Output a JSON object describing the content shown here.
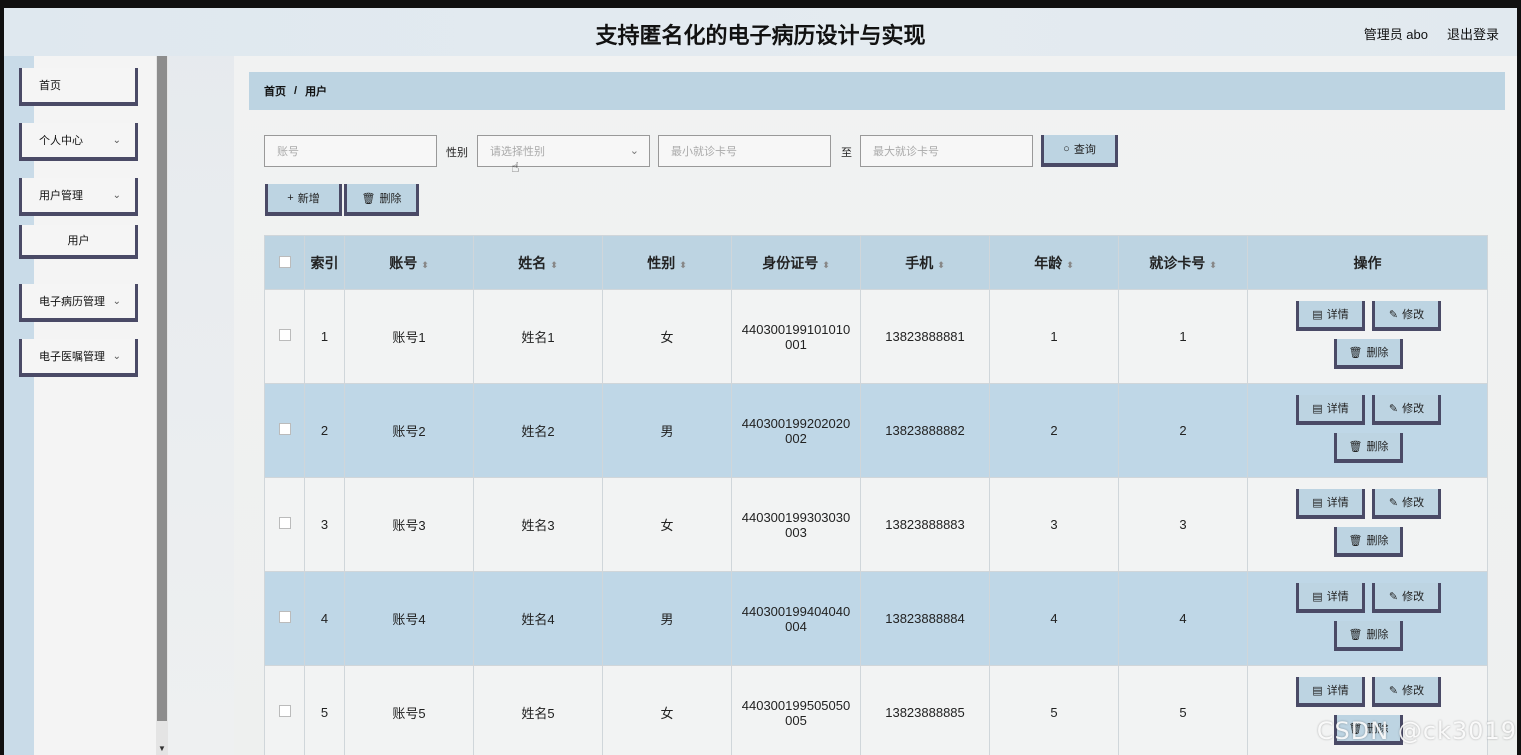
{
  "header": {
    "title": "支持匿名化的电子病历设计与实现",
    "user": "管理员 abo",
    "logout": "退出登录"
  },
  "sidebar": {
    "items": [
      {
        "label": "首页"
      },
      {
        "label": "个人中心"
      },
      {
        "label": "用户管理"
      },
      {
        "label": "用户"
      },
      {
        "label": "电子病历管理"
      },
      {
        "label": "电子医嘱管理"
      }
    ]
  },
  "breadcrumb": {
    "home": "首页",
    "sep": "/",
    "current": "用户"
  },
  "search": {
    "account_placeholder": "账号",
    "gender_label": "性别",
    "gender_placeholder": "请选择性别",
    "min_card_placeholder": "最小就诊卡号",
    "to_label": "至",
    "max_card_placeholder": "最大就诊卡号",
    "query_label": "查询"
  },
  "actions": {
    "add_label": "新增",
    "delete_label": "删除"
  },
  "table": {
    "headers": [
      "索引",
      "账号",
      "姓名",
      "性别",
      "身份证号",
      "手机",
      "年龄",
      "就诊卡号",
      "操作"
    ],
    "rows": [
      {
        "index": "1",
        "account": "账号1",
        "name": "姓名1",
        "gender": "女",
        "id_number_line1": "440300199101010",
        "id_number_line2": "001",
        "phone": "13823888881",
        "age": "1",
        "card": "1"
      },
      {
        "index": "2",
        "account": "账号2",
        "name": "姓名2",
        "gender": "男",
        "id_number_line1": "440300199202020",
        "id_number_line2": "002",
        "phone": "13823888882",
        "age": "2",
        "card": "2"
      },
      {
        "index": "3",
        "account": "账号3",
        "name": "姓名3",
        "gender": "女",
        "id_number_line1": "440300199303030",
        "id_number_line2": "003",
        "phone": "13823888883",
        "age": "3",
        "card": "3"
      },
      {
        "index": "4",
        "account": "账号4",
        "name": "姓名4",
        "gender": "男",
        "id_number_line1": "440300199404040",
        "id_number_line2": "004",
        "phone": "13823888884",
        "age": "4",
        "card": "4"
      },
      {
        "index": "5",
        "account": "账号5",
        "name": "姓名5",
        "gender": "女",
        "id_number_line1": "440300199505050",
        "id_number_line2": "005",
        "phone": "13823888885",
        "age": "5",
        "card": "5"
      }
    ],
    "op_detail": "详情",
    "op_edit": "修改",
    "op_delete": "删除"
  },
  "watermark": "CSDN @ck3019",
  "colors": {
    "accent": "#bdd4e2",
    "border": "#4a4a66",
    "row_alt": "#bfd7e7"
  }
}
